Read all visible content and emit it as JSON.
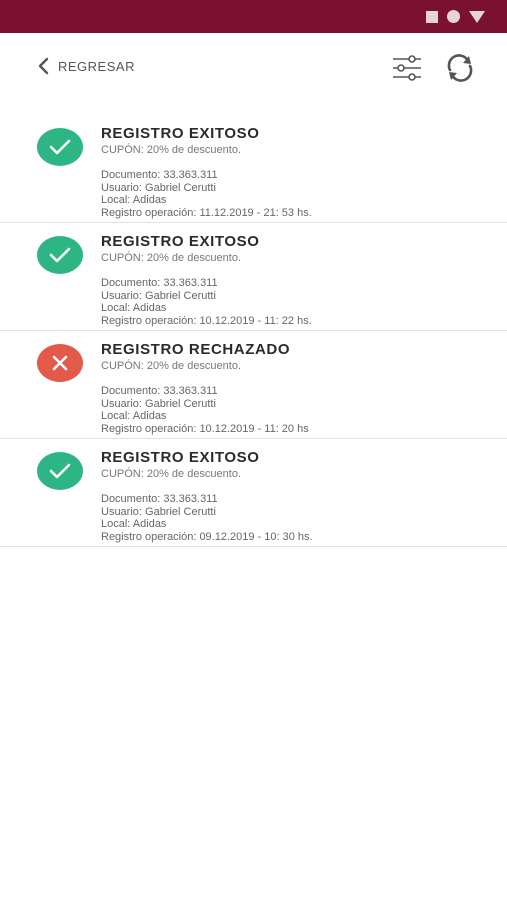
{
  "toolbar": {
    "back_label": "REGRESAR"
  },
  "records": [
    {
      "status": "ok",
      "title": "REGISTRO EXITOSO",
      "coupon": "CUPÓN: 20% de descuento.",
      "documento": "Documento: 33.363.311",
      "usuario": "Usuario: Gabriel Cerutti",
      "local": "Local: Adidas",
      "registro": "Registro operación: 11.12.2019 - 21: 53 hs."
    },
    {
      "status": "ok",
      "title": "REGISTRO EXITOSO",
      "coupon": "CUPÓN: 20% de descuento.",
      "documento": "Documento: 33.363.311",
      "usuario": "Usuario: Gabriel Cerutti",
      "local": "Local: Adidas",
      "registro": "Registro operación: 10.12.2019 - 11: 22 hs."
    },
    {
      "status": "fail",
      "title": "REGISTRO RECHAZADO",
      "coupon": "CUPÓN: 20% de descuento.",
      "documento": "Documento: 33.363.311",
      "usuario": "Usuario: Gabriel Cerutti",
      "local": "Local: Adidas",
      "registro": "Registro operación: 10.12.2019 - 11: 20 hs"
    },
    {
      "status": "ok",
      "title": "REGISTRO EXITOSO",
      "coupon": "CUPÓN: 20% de descuento.",
      "documento": "Documento: 33.363.311",
      "usuario": "Usuario: Gabriel Cerutti",
      "local": "Local: Adidas",
      "registro": "Registro operación: 09.12.2019 - 10: 30 hs."
    }
  ],
  "colors": {
    "status_bar": "#7b1130",
    "success": "#2db585",
    "error": "#e25a4a"
  },
  "icons": {
    "success": "check-icon",
    "error": "close-icon"
  }
}
